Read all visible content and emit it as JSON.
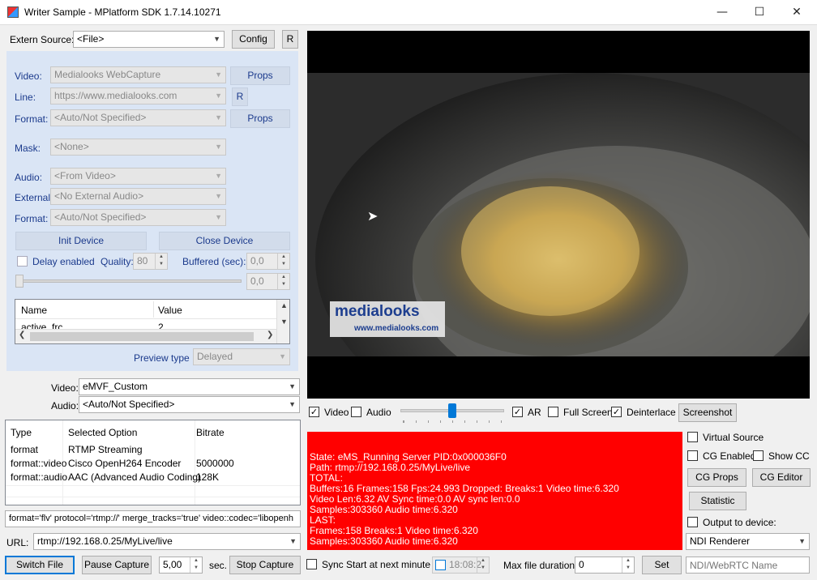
{
  "window": {
    "title": "Writer Sample - MPlatform SDK 1.7.14.10271",
    "minimize_icon": "minimize",
    "maximize_icon": "maximize",
    "close_icon": "close"
  },
  "source": {
    "label": "Extern Source:",
    "value": "<File>",
    "config_label": "Config",
    "r_label": "R"
  },
  "device": {
    "video_label": "Video:",
    "video_value": "Medialooks WebCapture",
    "video_props": "Props",
    "line_label": "Line:",
    "line_value": "https://www.medialooks.com",
    "line_r": "R",
    "format_label": "Format:",
    "format_value": "<Auto/Not Specified>",
    "format_props": "Props",
    "mask_label": "Mask:",
    "mask_value": "<None>",
    "audio_label": "Audio:",
    "audio_value": "<From Video>",
    "external_label": "External:",
    "external_value": "<No External Audio>",
    "aformat_label": "Format:",
    "aformat_value": "<Auto/Not Specified>",
    "init_label": "Init Device",
    "close_label": "Close Device",
    "delay_label": "Delay enabled",
    "quality_label": "Quality:",
    "quality_value": "80",
    "buffered_label": "Buffered (sec):",
    "buffered_value": "0,0",
    "slider_value": "0,0",
    "props_table": {
      "headers": [
        "Name",
        "Value"
      ],
      "rows": [
        [
          "active_frc",
          "2"
        ]
      ]
    },
    "preview_label": "Preview type",
    "preview_value": "Delayed"
  },
  "writer": {
    "video_label": "Video:",
    "video_value": "eMVF_Custom",
    "audio_label": "Audio:",
    "audio_value": "<Auto/Not Specified>"
  },
  "format_table": {
    "headers": [
      "Type",
      "Selected Option",
      "Bitrate"
    ],
    "rows": [
      [
        "format",
        "RTMP Streaming",
        ""
      ],
      [
        "format::video",
        "Cisco OpenH264 Encoder",
        "5000000"
      ],
      [
        "format::audio",
        "AAC (Advanced Audio Coding)",
        "128K"
      ]
    ]
  },
  "format_string": "format='flv' protocol='rtmp://' merge_tracks='true' video::codec='libopenh",
  "url": {
    "label": "URL:",
    "value": "rtmp://192.168.0.25/MyLive/live"
  },
  "bottom": {
    "switch": "Switch File",
    "pause": "Pause Capture",
    "interval": "5,00",
    "sec": "sec.",
    "stop": "Stop Capture",
    "sync_label": "Sync Start at next minute",
    "time_value": "18:08:2",
    "maxdur_label": "Max file duration:",
    "maxdur_value": "0",
    "set_label": "Set",
    "ndi_placeholder": "NDI/WebRTC Name"
  },
  "preview_controls": {
    "video": "Video",
    "audio": "Audio",
    "ar": "AR",
    "fullscreen": "Full Screen",
    "deinterlace": "Deinterlace",
    "screenshot": "Screenshot",
    "volume_level": 0.5
  },
  "logo": {
    "brand": "medialooks",
    "url": "www.medialooks.com"
  },
  "status_lines": [
    "State: eMS_Running Server PID:0x000036F0",
    " Path: rtmp://192.168.0.25/MyLive/live",
    "TOTAL:",
    "  Buffers:16 Frames:158 Fps:24.993 Dropped:  Breaks:1  Video time:6.320",
    "  Video Len:6.32 AV Sync time:0.0 AV sync len:0.0",
    "  Samples:303360 Audio time:6.320",
    "LAST:",
    "  Frames:158 Breaks:1 Video time:6.320",
    "  Samples:303360 Audio time:6.320"
  ],
  "right": {
    "virtual": "Virtual Source",
    "cg_enabled": "CG Enabled",
    "show_cc": "Show CC",
    "cg_props": "CG Props",
    "cg_editor": "CG Editor",
    "statistic": "Statistic",
    "output": "Output to device:",
    "renderer": "NDI Renderer"
  },
  "colors": {
    "status_bg": "#ff0000",
    "panel_bg": "#dae5f5",
    "accent": "#0078d7"
  }
}
